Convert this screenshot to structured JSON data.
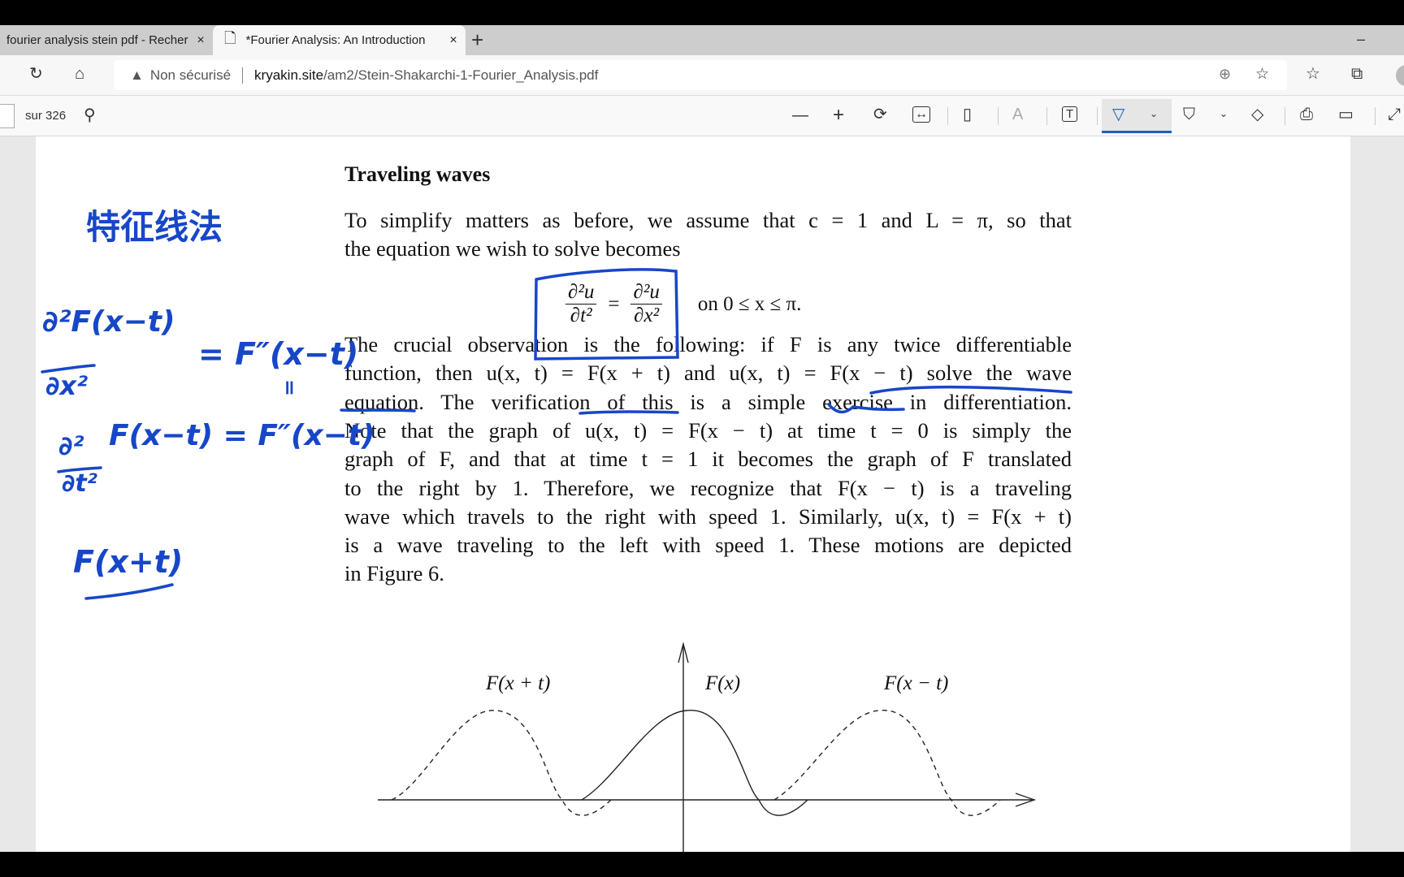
{
  "browser": {
    "tabs": [
      {
        "label": "fourier analysis stein pdf - Recherche",
        "active": false
      },
      {
        "label": "*Fourier Analysis: An Introduction",
        "active": true
      }
    ],
    "new_tab": "+",
    "close": "×",
    "minimize": "–",
    "security": "Non sécurisé",
    "url_host": "kryakin.site",
    "url_path": "/am2/Stein-Shakarchi-1-Fourier_Analysis.pdf"
  },
  "pdf_toolbar": {
    "page_total": "sur 326",
    "active_tool": "draw",
    "accent": "#1f5fbf"
  },
  "document": {
    "title": "Traveling waves",
    "para1": [
      "To simplify matters as before, we assume that c = 1 and L = π, so that",
      "the equation we wish to solve becomes"
    ],
    "equation": {
      "lhs_num": "∂²u",
      "lhs_den": "∂t²",
      "eq": "=",
      "rhs_num": "∂²u",
      "rhs_den": "∂x²",
      "domain": "on 0 ≤ x ≤ π."
    },
    "para2": [
      "The crucial observation is the following: if F is any twice differentiable",
      "function, then u(x, t) = F(x + t) and u(x, t) = F(x − t) solve the wave",
      "equation. The verification of this is a simple exercise in differentiation.",
      "Note that the graph of u(x, t) = F(x − t) at time t = 0 is simply the",
      "graph of F, and that at time t = 1 it becomes the graph of F translated",
      "to the right by 1. Therefore, we recognize that F(x − t) is a traveling",
      "wave which travels to the right with speed 1. Similarly, u(x, t) = F(x + t)",
      "is a wave traveling to the left with speed 1. These motions are depicted",
      "in Figure 6."
    ],
    "figure_labels": {
      "left": "F(x + t)",
      "center": "F(x)",
      "right": "F(x − t)"
    }
  },
  "annotations": {
    "color": "#1747c8",
    "heading": "特征线法",
    "eq1_num": "∂²F(x−t)",
    "eq1_den": "∂x²",
    "eq1_rhs": "= F″(x−t)",
    "equals_mark": "॥",
    "eq2_num": "∂²",
    "eq2_den": "∂t²",
    "eq2_rhs": "F(x−t) = F″(x−t)",
    "note": "F(x+t)"
  }
}
